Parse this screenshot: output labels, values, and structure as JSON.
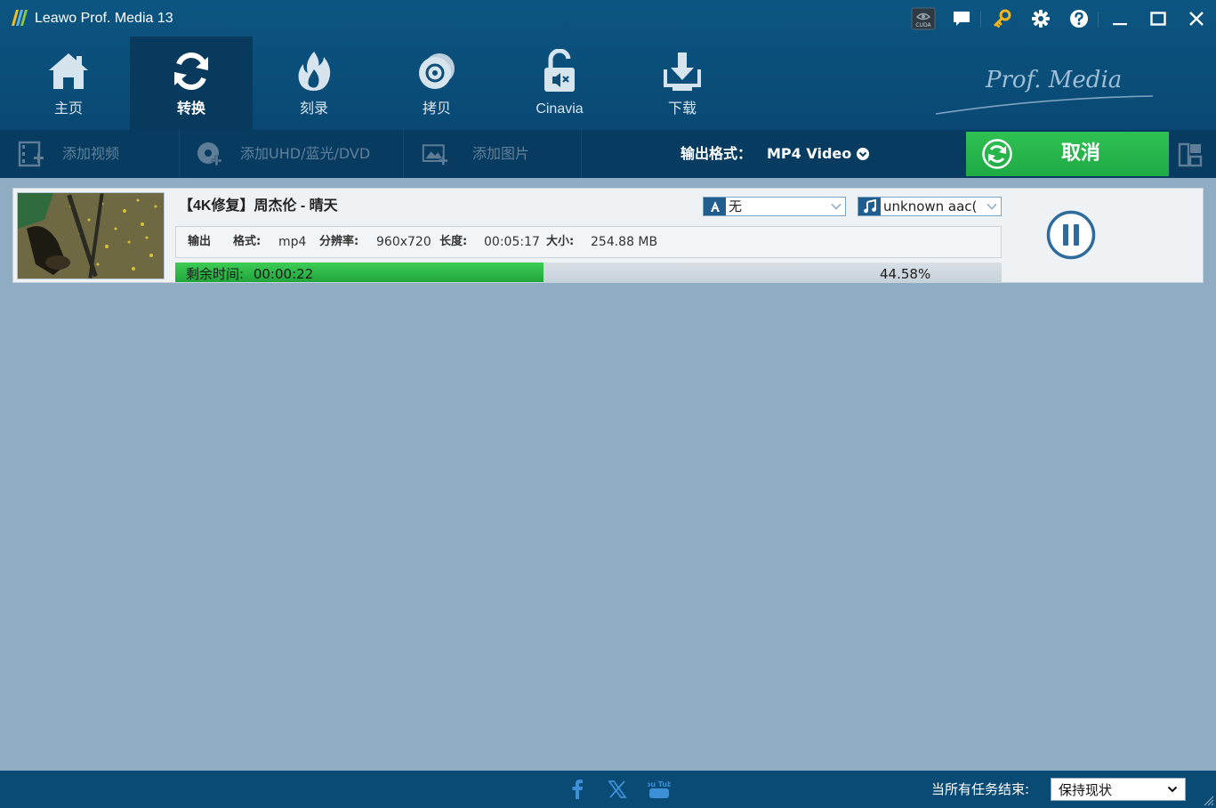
{
  "app": {
    "title": "Leawo Prof. Media 13",
    "brand_text": "Prof. Media"
  },
  "title_bar": {
    "icons": [
      "cuda-icon",
      "feedback-icon",
      "register-key-icon",
      "settings-icon",
      "help-icon",
      "minimize-icon",
      "maximize-icon",
      "close-icon"
    ],
    "cuda_label": "CUDA"
  },
  "main_tabs": [
    {
      "label": "主页",
      "icon": "home-icon",
      "active": false
    },
    {
      "label": "转换",
      "icon": "convert-icon",
      "active": true
    },
    {
      "label": "刻录",
      "icon": "burn-icon",
      "active": false
    },
    {
      "label": "拷贝",
      "icon": "copy-disc-icon",
      "active": false
    },
    {
      "label": "Cinavia",
      "icon": "cinavia-unlock-icon",
      "active": false
    },
    {
      "label": "下载",
      "icon": "download-icon",
      "active": false
    }
  ],
  "toolbar": {
    "add_video": "添加视频",
    "add_disc": "添加UHD/蓝光/DVD",
    "add_photo": "添加图片",
    "output_format_label": "输出格式：",
    "output_format_value": "MP4 Video",
    "cancel_label": "取消"
  },
  "task": {
    "title": "【4K修复】周杰伦 - 晴天",
    "subtitle_value": "无",
    "audio_value": "unknown aac(",
    "output_label": "输出",
    "format_key": "格式:",
    "format_value": "mp4",
    "resolution_key": "分辨率:",
    "resolution_value": "960x720",
    "duration_key": "长度:",
    "duration_value": "00:05:17",
    "size_key": "大小:",
    "size_value": "254.88 MB",
    "remaining_label": "剩余时间:",
    "remaining_value": "00:00:22",
    "progress_percent_text": "44.58%",
    "progress_fraction": 0.4458
  },
  "status_bar": {
    "social_icons": [
      "facebook-icon",
      "x-twitter-icon",
      "youtube-icon"
    ],
    "youtube_text": "You Tube",
    "on_complete_label": "当所有任务结束:",
    "on_complete_value": "保持现状"
  },
  "colors": {
    "header_bg": "#0c5582",
    "toolbar_bg": "#073b60",
    "workspace_bg": "#8fadc2",
    "cancel_green": "#22ad46",
    "progress_green": "#2cb847",
    "pause_blue": "#2c6b9c",
    "key_yellow": "#f2b51c"
  }
}
